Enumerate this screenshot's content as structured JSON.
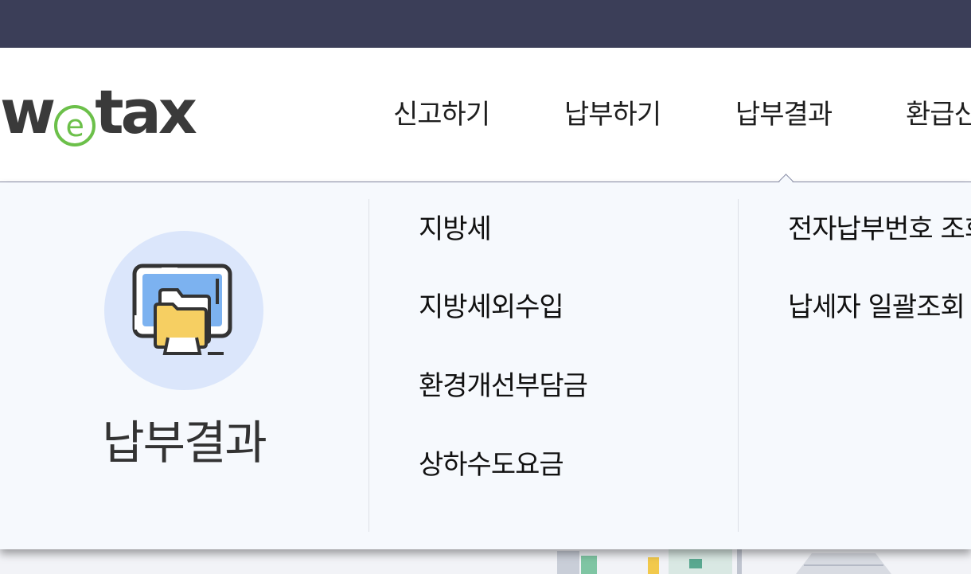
{
  "logo": {
    "text_before": "w",
    "text_e": "e",
    "text_after": "tax"
  },
  "nav": {
    "items": [
      {
        "label": "신고하기"
      },
      {
        "label": "납부하기"
      },
      {
        "label": "납부결과"
      },
      {
        "label": "환급신청"
      }
    ],
    "active_index": 2
  },
  "dropdown": {
    "section_title": "납부결과",
    "icon": "computer-folder-icon",
    "col1": [
      {
        "label": "지방세"
      },
      {
        "label": "지방세외수입"
      },
      {
        "label": "환경개선부담금"
      },
      {
        "label": "상하수도요금"
      }
    ],
    "col2": [
      {
        "label": "전자납부번호 조회"
      },
      {
        "label": "납세자 일괄조회"
      }
    ]
  },
  "colors": {
    "topbar": "#3b3e58",
    "logo_text": "#3a3a3a",
    "logo_accent": "#6cc04a",
    "dropdown_bg": "#f6f9fd",
    "icon_circle": "#dbe6fb"
  }
}
